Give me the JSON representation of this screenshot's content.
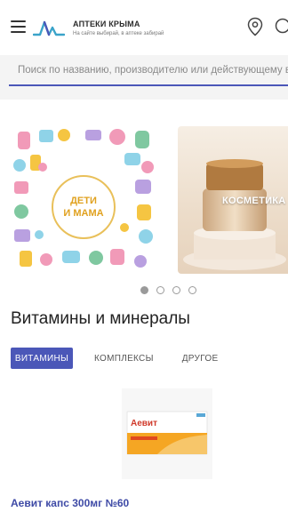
{
  "header": {
    "title": "АПТЕКИ КРЫМА",
    "subtitle": "На сайте выбирай, в аптеке забирай",
    "accent_color": "#4b57b8"
  },
  "search": {
    "placeholder": "Поиск по названию, производителю или действующему веществу"
  },
  "banners": [
    {
      "label_line1": "ДЕТИ",
      "label_line2": "И МАМА"
    },
    {
      "label": "КОСМЕТИКА"
    }
  ],
  "carousel": {
    "pages": 4,
    "active": 1
  },
  "section": {
    "title": "Витамины и минералы",
    "tabs": [
      {
        "label": "ВИТАМИНЫ",
        "active": true
      },
      {
        "label": "КОМПЛЕКСЫ",
        "active": false
      },
      {
        "label": "ДРУГОЕ",
        "active": false
      }
    ]
  },
  "product": {
    "package_name": "Аевит",
    "name": "Аевит капс 300мг №60"
  }
}
